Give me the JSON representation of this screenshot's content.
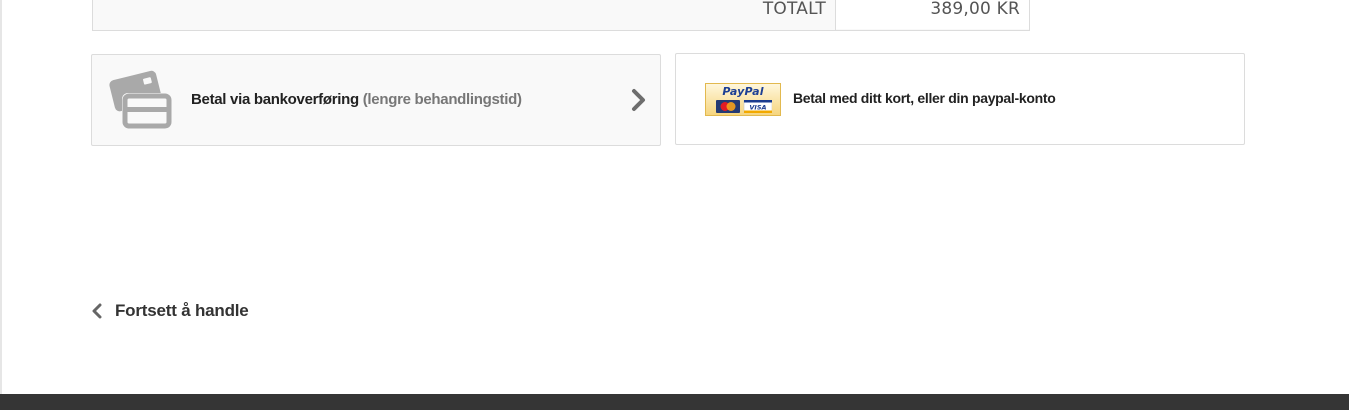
{
  "totals": {
    "label": "TOTALT",
    "value": "389,00 KR"
  },
  "payment": {
    "bank": {
      "label": "Betal via bankoverføring",
      "note": "(lengre behandlingstid)",
      "icon": "credit-card-icon",
      "action_icon": "chevron-right-icon"
    },
    "paypal": {
      "logo_text": "PayPal",
      "card_brands": [
        "MasterCard",
        "VISA"
      ],
      "label": "Betal med ditt kort, eller din paypal-konto"
    }
  },
  "continue_shopping": {
    "label": "Fortsett å handle",
    "icon": "chevron-left-icon"
  },
  "colors": {
    "footer": "#353535",
    "box_border": "#dcdcdc",
    "paypal_blue": "#1c3f94"
  }
}
